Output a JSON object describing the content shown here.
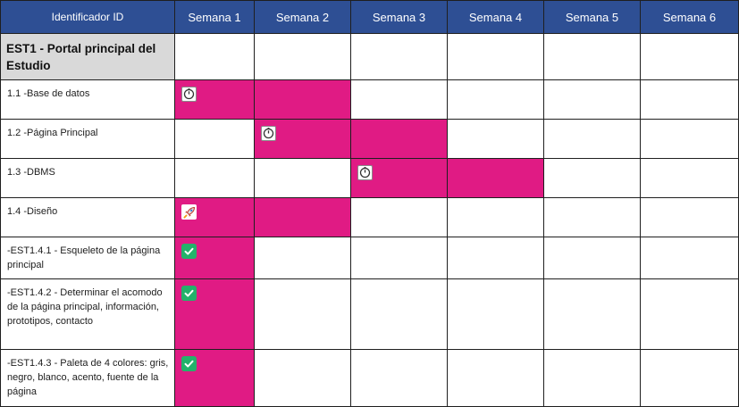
{
  "header": {
    "id_label": "Identificador ID",
    "weeks": [
      "Semana 1",
      "Semana 2",
      "Semana 3",
      "Semana 4",
      "Semana 5",
      "Semana 6"
    ]
  },
  "colors": {
    "header_bg": "#2e4f94",
    "bar_fill": "#e01b84",
    "group_bg": "#d9d9d9",
    "check_green": "#23b26a"
  },
  "rows": [
    {
      "label": "EST1 - Portal principal del Estudio",
      "group": true,
      "filled_weeks": [],
      "icon": null
    },
    {
      "label": "1.1 -Base de datos",
      "filled_weeks": [
        1,
        2
      ],
      "icon": "timer-icon"
    },
    {
      "label": "1.2 -Página Principal",
      "filled_weeks": [
        2,
        3
      ],
      "icon": "timer-icon"
    },
    {
      "label": "1.3 -DBMS",
      "filled_weeks": [
        3,
        4
      ],
      "icon": "timer-icon"
    },
    {
      "label": "1.4 -Diseño",
      "filled_weeks": [
        1,
        2
      ],
      "icon": "rocket-icon"
    },
    {
      "label": "-EST1.4.1 - Esqueleto de la página principal",
      "filled_weeks": [
        1
      ],
      "icon": "checkmark-icon"
    },
    {
      "label": "-EST1.4.2 - Determinar el acomodo de la página principal, información, prototipos, contacto",
      "filled_weeks": [
        1
      ],
      "icon": "checkmark-icon"
    },
    {
      "label": "-EST1.4.3 - Paleta de 4 colores: gris, negro, blanco, acento, fuente de la página",
      "filled_weeks": [
        1
      ],
      "icon": "checkmark-icon"
    }
  ]
}
